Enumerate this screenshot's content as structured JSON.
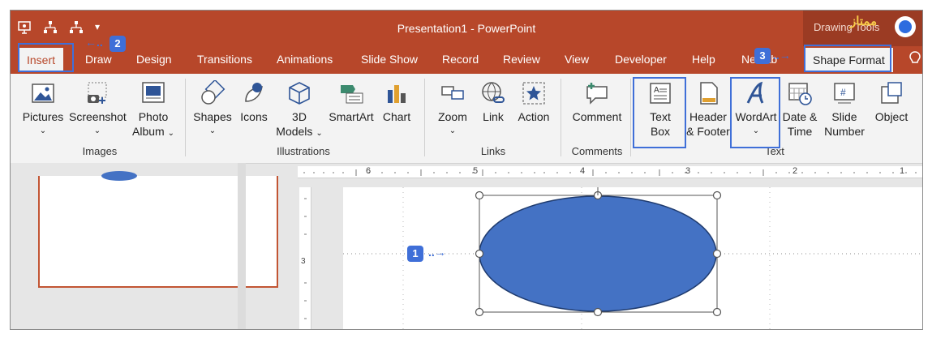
{
  "window": {
    "title": "Presentation1  -  PowerPoint",
    "contextual_group": "Drawing Tools",
    "brand_logo_text": "ممتاز"
  },
  "tabs": [
    {
      "label": "Insert"
    },
    {
      "label": "Draw"
    },
    {
      "label": "Design"
    },
    {
      "label": "Transitions"
    },
    {
      "label": "Animations"
    },
    {
      "label": "Slide Show"
    },
    {
      "label": "Record"
    },
    {
      "label": "Review"
    },
    {
      "label": "View"
    },
    {
      "label": "Developer"
    },
    {
      "label": "Help"
    },
    {
      "label": "Ne Tab"
    },
    {
      "label": "Shape Format"
    }
  ],
  "callouts": {
    "one": "1",
    "two": "2",
    "three": "3"
  },
  "ribbon": {
    "images": {
      "label": "Images",
      "pictures": "Pictures",
      "screenshot": "Screenshot",
      "photo_album_1": "Photo",
      "photo_album_2": "Album"
    },
    "illustrations": {
      "label": "Illustrations",
      "shapes": "Shapes",
      "icons": "Icons",
      "models_1": "3D",
      "models_2": "Models",
      "smartart": "SmartArt",
      "chart": "Chart"
    },
    "links": {
      "label": "Links",
      "zoom": "Zoom",
      "link": "Link",
      "action": "Action"
    },
    "comments": {
      "label": "Comments",
      "comment": "Comment"
    },
    "text": {
      "label": "Text",
      "text_box_1": "Text",
      "text_box_2": "Box",
      "header_1": "Header",
      "header_2": "& Footer",
      "wordart": "WordArt",
      "date_1": "Date &",
      "date_2": "Time",
      "slide_num_1": "Slide",
      "slide_num_2": "Number",
      "object": "Object"
    }
  },
  "ruler": {
    "ticks": [
      "6",
      "5",
      "4",
      "3",
      "2",
      "1"
    ],
    "left_tick": "3"
  },
  "colors": {
    "accent": "#b7472a",
    "highlight": "#3f6fd8",
    "shape_fill": "#4472c4"
  }
}
